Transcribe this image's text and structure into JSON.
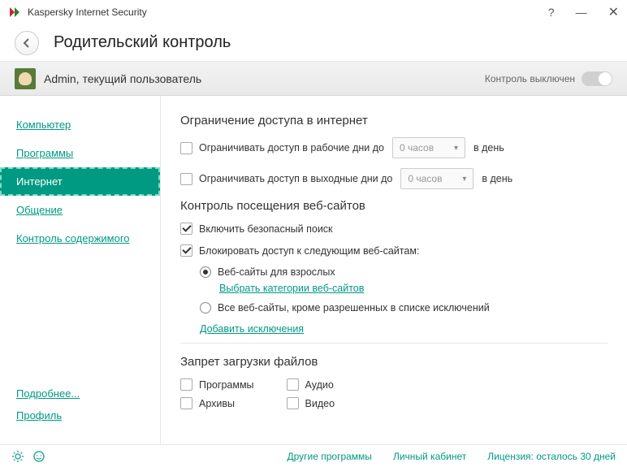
{
  "app": {
    "title": "Kaspersky Internet Security"
  },
  "header": {
    "title": "Родительский контроль"
  },
  "user": {
    "name": "Admin, текущий пользователь",
    "control_status": "Контроль выключен"
  },
  "sidebar": {
    "items": [
      {
        "label": "Компьютер"
      },
      {
        "label": "Программы"
      },
      {
        "label": "Интернет"
      },
      {
        "label": "Общение"
      },
      {
        "label": "Контроль содержимого"
      }
    ],
    "more": "Подробнее...",
    "profile": "Профиль"
  },
  "content": {
    "section1_title": "Ограничение доступа в интернет",
    "limit_workdays": "Ограничивать доступ в рабочие дни до",
    "limit_weekend": "Ограничивать доступ в выходные дни до",
    "dropdown_value": "0 часов",
    "per_day": "в день",
    "section2_title": "Контроль посещения веб-сайтов",
    "safe_search": "Включить безопасный поиск",
    "block_access": "Блокировать доступ к следующим веб-сайтам:",
    "adult_sites": "Веб-сайты для взрослых",
    "choose_categories": "Выбрать категории веб-сайтов",
    "all_except": "Все веб-сайты, кроме разрешенных в списке исключений",
    "add_exceptions": "Добавить исключения",
    "section3_title": "Запрет загрузки файлов",
    "file_types": {
      "programs": "Программы",
      "archives": "Архивы",
      "audio": "Аудио",
      "video": "Видео"
    }
  },
  "bottom": {
    "other": "Другие программы",
    "cabinet": "Личный кабинет",
    "license": "Лицензия: осталось 30 дней"
  }
}
